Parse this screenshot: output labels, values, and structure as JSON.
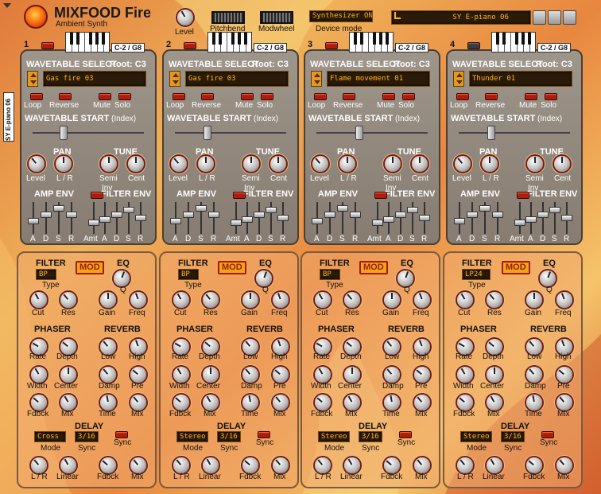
{
  "app": {
    "title": "MIXFOOD Fire",
    "subtitle": "Ambient Synth",
    "vertical_label": "SY E-piano 06"
  },
  "top": {
    "level_label": "Level",
    "pitchbend_label": "Pitchbend",
    "modwheel_label": "Modwheel",
    "device_mode_value": "Synthesizer ON",
    "device_mode_label": "Device mode",
    "preset_name": "SY E-piano 06"
  },
  "labels": {
    "wavetable_select": "WAVETABLE SELECT",
    "loop": "Loop",
    "reverse": "Reverse",
    "mute": "Mute",
    "solo": "Solo",
    "wavetable_start": "WAVETABLE START",
    "index": "(Index)",
    "pan": "PAN",
    "tune": "TUNE",
    "level": "Level",
    "lr": "L / R",
    "semi": "Semi",
    "cent": "Cent",
    "amp_env": "AMP ENV",
    "filter_env": "FILTER ENV",
    "inv": "Inv",
    "a": "A",
    "d": "D",
    "s": "S",
    "r": "R",
    "amt": "Amt",
    "filter": "FILTER",
    "mod": "MOD",
    "eq": "EQ",
    "type": "Type",
    "q": "Q",
    "cut": "Cut",
    "res": "Res",
    "gain": "Gain",
    "freq": "Freq",
    "phaser": "PHASER",
    "reverb": "REVERB",
    "rate": "Rate",
    "depth": "Depth",
    "low": "Low",
    "high": "High",
    "width": "Width",
    "center": "Center",
    "damp": "Damp",
    "pre": "Pre",
    "fdbck": "Fdbck",
    "mix": "Mix",
    "time": "Time",
    "delay": "DELAY",
    "mode": "Mode",
    "sync": "Sync",
    "linear": "Linear"
  },
  "slots": [
    {
      "num": "1",
      "range": "C-2 / G8",
      "root": "Root: C3",
      "wavetable": "Gas fire 03",
      "filter_type": "BP",
      "delay_mode": "Cross",
      "delay_sync": "3/16",
      "slot_led": "on"
    },
    {
      "num": "2",
      "range": "C-2 / G8",
      "root": "Root: C3",
      "wavetable": "Gas fire 03",
      "filter_type": "BP",
      "delay_mode": "Stereo",
      "delay_sync": "3/16",
      "slot_led": "on"
    },
    {
      "num": "3",
      "range": "C-2 / G8",
      "root": "Root: C3",
      "wavetable": "Flame movement 01",
      "filter_type": "BP",
      "delay_mode": "Stereo",
      "delay_sync": "3/16",
      "slot_led": "on"
    },
    {
      "num": "4",
      "range": "C-2 / G8",
      "root": "Root: C3",
      "wavetable": "Thunder 01",
      "filter_type": "LP24",
      "delay_mode": "Stereo",
      "delay_sync": "3/16",
      "slot_led": "off"
    }
  ],
  "colors": {
    "led_on": "#b01c0c",
    "lcd_text": "#ffb21a",
    "panel_gray": "#8f867b",
    "mod_button": "#f2a31a"
  }
}
